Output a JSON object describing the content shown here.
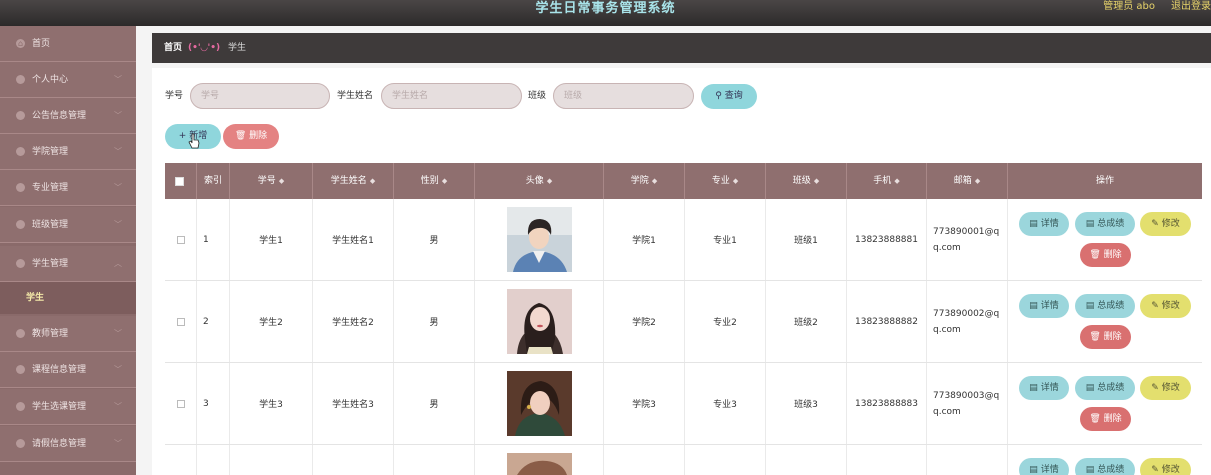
{
  "app": {
    "title": "学生日常事务管理系统",
    "admin": "管理员 abo",
    "logout": "退出登录"
  },
  "sidebar": {
    "items": [
      {
        "label": "首页",
        "icon": "home-icon"
      },
      {
        "label": "个人中心",
        "icon": "user-icon"
      },
      {
        "label": "公告信息管理",
        "icon": "notice-icon"
      },
      {
        "label": "学院管理",
        "icon": "college-icon"
      },
      {
        "label": "专业管理",
        "icon": "major-icon"
      },
      {
        "label": "班级管理",
        "icon": "class-icon"
      },
      {
        "label": "学生管理",
        "icon": "student-icon"
      },
      {
        "label": "教师管理",
        "icon": "teacher-icon"
      },
      {
        "label": "课程信息管理",
        "icon": "course-icon"
      },
      {
        "label": "学生选课管理",
        "icon": "select-course-icon"
      },
      {
        "label": "请假信息管理",
        "icon": "leave-icon"
      }
    ],
    "active_sub": "学生"
  },
  "breadcrumb": {
    "home": "首页",
    "emoticon": "(•'◡'•)",
    "current": "学生"
  },
  "search": {
    "student_no_label": "学号",
    "student_no_placeholder": "学号",
    "name_label": "学生姓名",
    "name_placeholder": "学生姓名",
    "class_label": "班级",
    "class_placeholder": "班级",
    "query_label": "查询"
  },
  "actions": {
    "add_label": "新增",
    "delete_label": "删除"
  },
  "table": {
    "headers": [
      "索引",
      "学号",
      "学生姓名",
      "性别",
      "头像",
      "学院",
      "专业",
      "班级",
      "手机",
      "邮箱",
      "操作"
    ],
    "rows": [
      {
        "index": "1",
        "student_no": "学生1",
        "name": "学生姓名1",
        "gender": "男",
        "college": "学院1",
        "major": "专业1",
        "class": "班级1",
        "phone": "13823888881",
        "email": "773890001@qq.com"
      },
      {
        "index": "2",
        "student_no": "学生2",
        "name": "学生姓名2",
        "gender": "男",
        "college": "学院2",
        "major": "专业2",
        "class": "班级2",
        "phone": "13823888882",
        "email": "773890002@qq.com"
      },
      {
        "index": "3",
        "student_no": "学生3",
        "name": "学生姓名3",
        "gender": "男",
        "college": "学院3",
        "major": "专业3",
        "class": "班级3",
        "phone": "13823888883",
        "email": "773890003@qq.com"
      }
    ],
    "row_buttons": {
      "detail": "详情",
      "score": "总成绩",
      "edit": "修改",
      "delete": "删除"
    }
  },
  "colors": {
    "topbar": "#3a3636",
    "sidebar": "#8f6f6f",
    "accent_cyan": "#8fd6dc",
    "danger": "#e48282",
    "edit_yellow": "#e3df6e"
  }
}
